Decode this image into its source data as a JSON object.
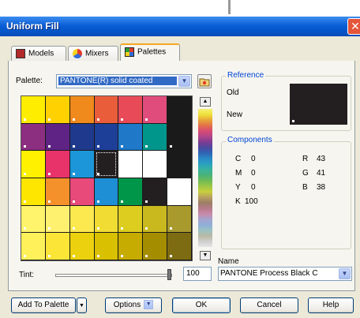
{
  "window": {
    "title": "Uniform Fill",
    "close_glyph": "✕"
  },
  "tabs": [
    {
      "label": "Models",
      "icon": "models-icon"
    },
    {
      "label": "Mixers",
      "icon": "mixers-icon"
    },
    {
      "label": "Palettes",
      "icon": "palettes-icon",
      "active": true
    }
  ],
  "palette": {
    "label": "Palette:",
    "value": "PANTONE(R) solid coated"
  },
  "reference": {
    "title": "Reference",
    "old_label": "Old",
    "new_label": "New",
    "new_color": "#231f20"
  },
  "components": {
    "title": "Components",
    "left": [
      {
        "label": "C",
        "value": "0"
      },
      {
        "label": "M",
        "value": "0"
      },
      {
        "label": "Y",
        "value": "0"
      },
      {
        "label": "K",
        "value": "100"
      }
    ],
    "right": [
      {
        "label": "R",
        "value": "43"
      },
      {
        "label": "G",
        "value": "41"
      },
      {
        "label": "B",
        "value": "38"
      }
    ]
  },
  "name": {
    "label": "Name",
    "value": "PANTONE Process Black C"
  },
  "tint": {
    "label": "Tint:",
    "value": "100",
    "level_percent": 100
  },
  "buttons": {
    "add": "Add To Palette",
    "options": "Options",
    "ok": "OK",
    "cancel": "Cancel",
    "help": "Help"
  },
  "swatch_colors": [
    [
      "#ffed00",
      "#ffd100",
      "#f08a1c",
      "#ea5d3b",
      "#e84a57",
      "#e04d7d"
    ],
    [
      "#8c2f80",
      "#5e2384",
      "#1f3a8c",
      "#1e3f98",
      "#1f78c8",
      "#00968c",
      "#1a1a1a"
    ],
    [
      "#fff100",
      "#e8336a",
      "#1c96d8",
      "#231f20",
      "#ffffff",
      "#ffffff"
    ],
    [
      "#ffe600",
      "#f5912a",
      "#e84a7a",
      "#1e8fd5",
      "#00964a",
      "#231f20",
      "#ffffff"
    ],
    [
      "#fff46b",
      "#fff170",
      "#fce94f",
      "#f0dc33",
      "#dccd1f",
      "#c9b81e",
      "#a89a2d"
    ],
    [
      "#fff15a",
      "#fbe536",
      "#ecd20e",
      "#d9c000",
      "#c6ab00",
      "#a58d00",
      "#7e6c13"
    ]
  ],
  "selected_swatch": {
    "row": 2,
    "col": 3
  },
  "colors": {
    "accent": "#0046d5",
    "title_bar": "#0453c6",
    "selected": "#231f20"
  }
}
